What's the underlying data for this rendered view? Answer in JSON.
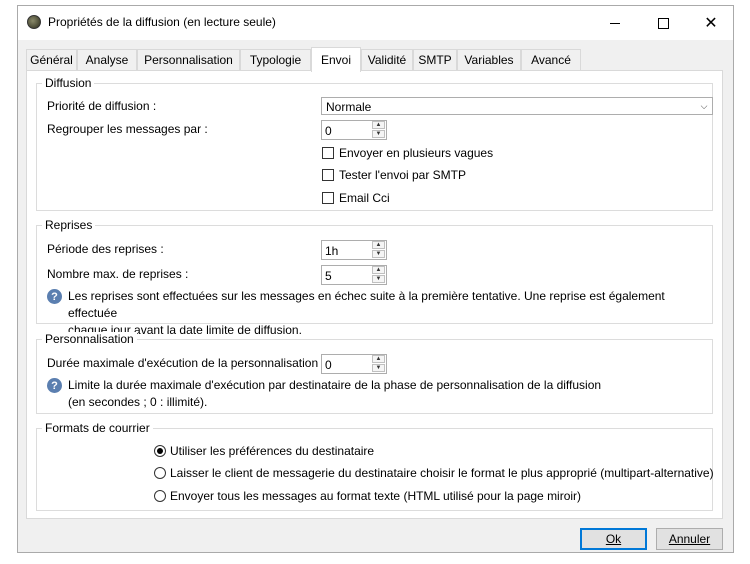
{
  "window": {
    "title": "Propriétés de la diffusion (en lecture seule)",
    "minimize": "minimize",
    "maximize": "maximize",
    "close": "✕"
  },
  "tabs": [
    "Général",
    "Analyse",
    "Personnalisation",
    "Typologie",
    "Envoi",
    "Validité",
    "SMTP",
    "Variables",
    "Avancé"
  ],
  "active_tab": "Envoi",
  "diffusion": {
    "title": "Diffusion",
    "priority_label": "Priorité de diffusion :",
    "priority_value": "Normale",
    "group_label": "Regrouper les messages par :",
    "group_value": "0",
    "waves_label": "Envoyer en plusieurs vagues",
    "test_smtp_label": "Tester l'envoi par SMTP",
    "email_cci_label": "Email Cci"
  },
  "reprises": {
    "title": "Reprises",
    "period_label": "Période des reprises :",
    "period_value": "1h",
    "max_label": "Nombre max. de reprises :",
    "max_value": "5",
    "info_line1": "Les reprises sont effectuées sur les messages en échec suite à la première tentative. Une reprise est également effectuée",
    "info_line2": "chaque jour avant la date limite de diffusion."
  },
  "personnalisation": {
    "title": "Personnalisation",
    "duration_label": "Durée maximale d'exécution de la personnalisation :",
    "duration_value": "0",
    "info_line1": "Limite la durée maximale d'exécution par destinataire de la phase de personnalisation de la diffusion",
    "info_line2": "(en secondes ; 0 : illimité)."
  },
  "formats": {
    "title": "Formats de courrier",
    "option1": "Utiliser les préférences du destinataire",
    "option2": "Laisser le client de messagerie du destinataire choisir le format le plus approprié (multipart-alternative)",
    "option3": "Envoyer tous les messages au format texte (HTML utilisé pour la page miroir)",
    "selected": 1
  },
  "buttons": {
    "ok": "Ok",
    "cancel": "Annuler"
  }
}
